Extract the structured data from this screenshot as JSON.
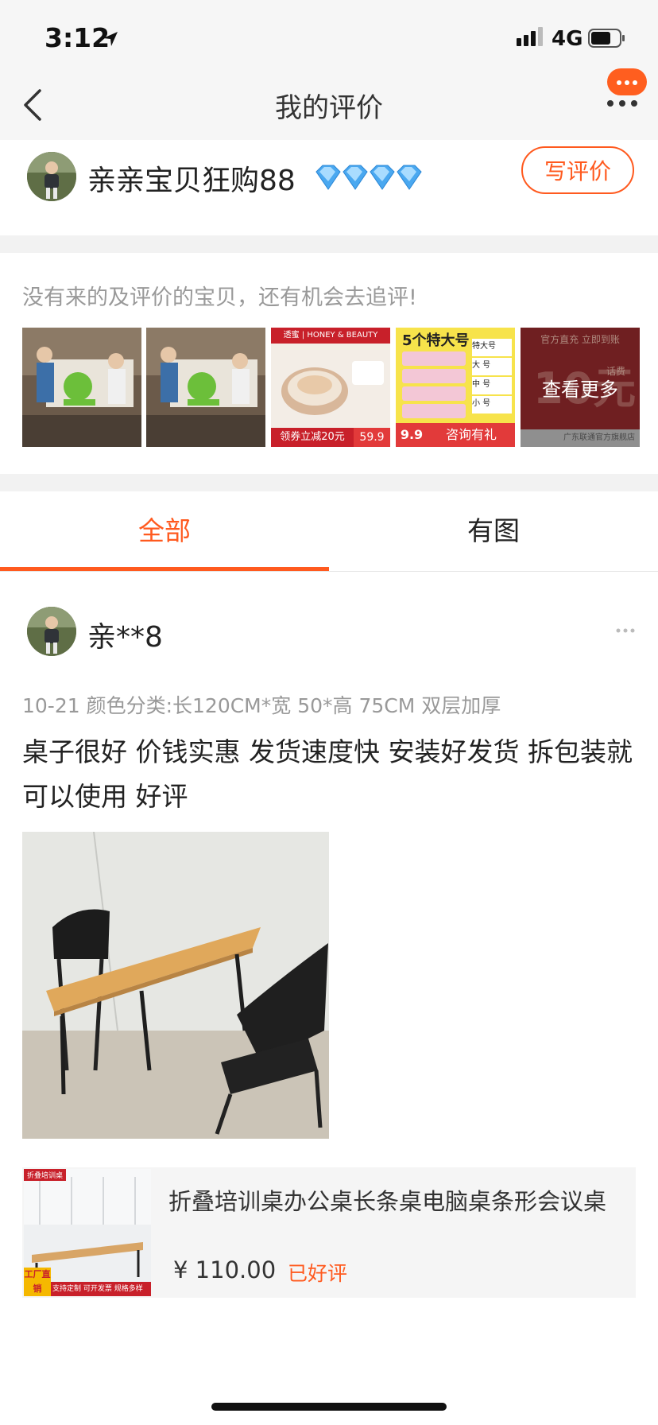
{
  "status_bar": {
    "time": "3:12",
    "network": "4G"
  },
  "nav": {
    "title": "我的评价"
  },
  "profile": {
    "name": "亲亲宝贝狂购88",
    "write_review": "写评价"
  },
  "pending": {
    "text": "没有来的及评价的宝贝，还有机会去追评!",
    "see_more": "查看更多"
  },
  "thumbs": [
    {
      "caption": ""
    },
    {
      "caption": ""
    },
    {
      "brand": "透蜜 | HONEY & BEAUTY",
      "badge": "领券立减20元",
      "price": "59.9"
    },
    {
      "headline": "5个特大号",
      "sizes": [
        "特大号",
        "大 号",
        "中 号",
        "小 号"
      ],
      "price": "9.9",
      "cta": "咨询有礼"
    },
    {
      "banner": "官方直充 立即到账",
      "value": "10元",
      "tag": "话费",
      "store": "广东联通官方旗舰店"
    }
  ],
  "tabs": {
    "all": "全部",
    "with_photo": "有图"
  },
  "review": {
    "user": "亲**8",
    "meta": "10-21 颜色分类:长120CM*宽 50*高 75CM 双层加厚",
    "text": "桌子很好 价钱实惠 发货速度快 安装好发货 拆包装就可以使用 好评",
    "product": {
      "name": "折叠培训桌办公桌长条桌电脑桌条形会议桌",
      "price": "¥ 110.00",
      "status": "已好评",
      "img_tag": "折叠培训桌",
      "img_corner": "工厂直销",
      "img_footer": "支持定制 可开发票 规格多样"
    }
  },
  "colors": {
    "accent": "#ff5a1f",
    "background": "#ffffff",
    "gray_text": "#999999"
  }
}
